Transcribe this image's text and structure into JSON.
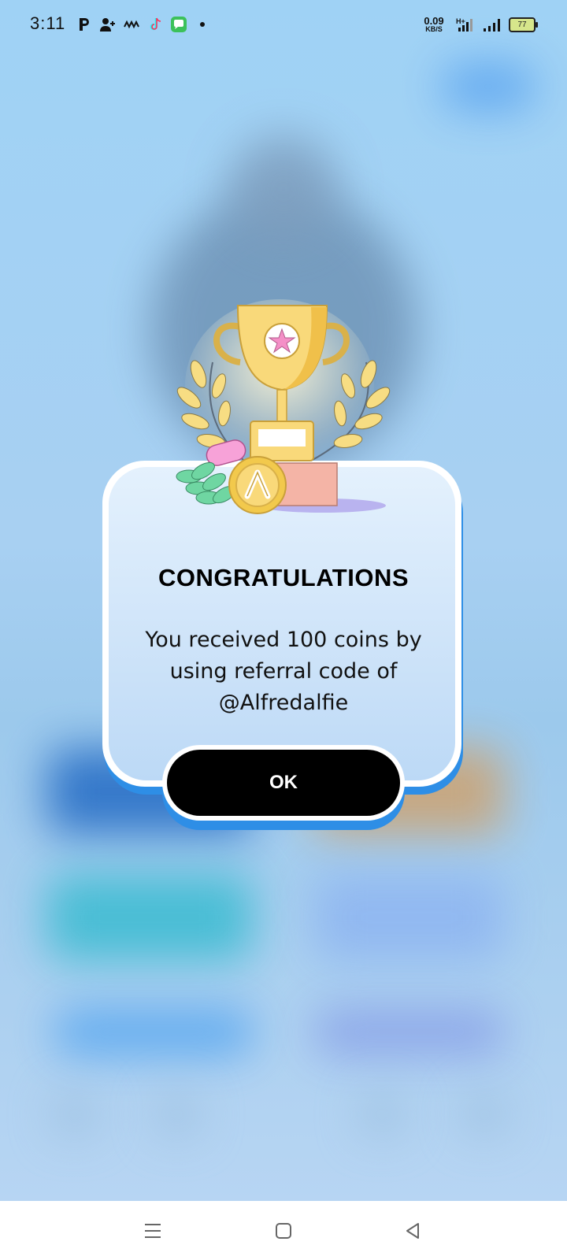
{
  "status_bar": {
    "time": "3:11",
    "net_speed_value": "0.09",
    "net_speed_unit": "KB/S",
    "battery_level": "77",
    "left_icons": [
      "parking-icon",
      "add-person-icon",
      "wave-icon",
      "tiktok-icon",
      "chat-app-icon",
      "dot-icon"
    ],
    "right_icons": [
      "signal-h-plus-icon",
      "signal-bars-icon",
      "battery-icon"
    ]
  },
  "dialog": {
    "title": "CONGRATULATIONS",
    "message": "You received 100 coins by using referral code of @Alfredalfie",
    "ok_label": "OK",
    "illustration": "trophy-illustration",
    "coin_icon": "coin-icon"
  },
  "nav_bar": {
    "icons": [
      "menu-icon",
      "home-icon",
      "back-icon"
    ]
  },
  "colors": {
    "accent_blue": "#2e8ee6",
    "button_black": "#000000",
    "trophy_gold": "#f9d97a"
  }
}
